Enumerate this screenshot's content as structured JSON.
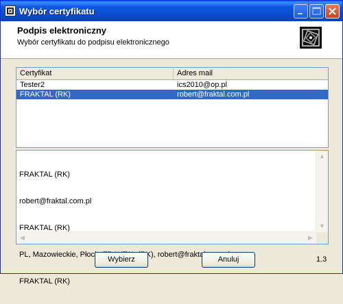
{
  "window": {
    "title": "Wybór certyfikatu"
  },
  "header": {
    "title": "Podpis elektroniczny",
    "subtitle": "Wybór certyfikatu do podpisu elektronicznego"
  },
  "cert_list": {
    "columns": [
      "Certyfikat",
      "Adres mail"
    ],
    "rows": [
      {
        "name": "Tester2",
        "email": "ics2010@op.pl",
        "selected": false
      },
      {
        "name": "FRAKTAL (RK)",
        "email": "robert@fraktal.com.pl",
        "selected": true
      }
    ]
  },
  "details": {
    "lines": [
      "FRAKTAL (RK)",
      "robert@fraktal.com.pl",
      "FRAKTAL (RK)",
      "PL, Mazowieckie, Płock, FRAKTAL (RK), robert@fraktal.com.pl",
      "FRAKTAL (RK)"
    ]
  },
  "buttons": {
    "select": "Wybierz",
    "cancel": "Anuluj"
  },
  "version": "1.3",
  "colors": {
    "titlebar": "#0a4ccf",
    "selection": "#316ac5",
    "dialog_bg": "#ece9d8"
  }
}
